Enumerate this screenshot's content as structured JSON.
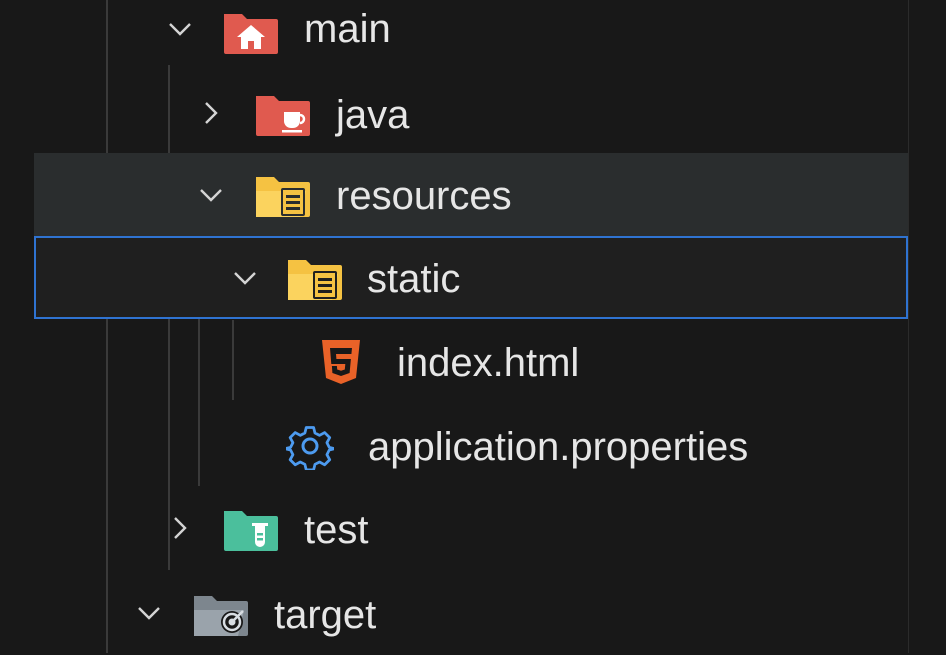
{
  "tree": {
    "main": {
      "label": "main",
      "expanded": true
    },
    "java": {
      "label": "java",
      "expanded": false
    },
    "resources": {
      "label": "resources",
      "expanded": true
    },
    "static": {
      "label": "static",
      "expanded": true,
      "selected": true
    },
    "index": {
      "label": "index.html"
    },
    "properties": {
      "label": "application.properties"
    },
    "test": {
      "label": "test",
      "expanded": false
    },
    "target": {
      "label": "target",
      "expanded": true
    }
  },
  "colors": {
    "background": "#181818",
    "hover_row": "#2a2d2e",
    "selection_border": "#2f73d1",
    "main_folder": "#e05a4f",
    "java_folder": "#e05a4f",
    "resources_folder": "#f5c242",
    "test_folder": "#4bbf9c",
    "target_folder": "#9aa3ab",
    "html_icon": "#e96228",
    "gear_icon": "#4d9bf0"
  },
  "icons": {
    "main": "folder-home-icon",
    "java": "folder-java-icon",
    "resources": "folder-resource-icon",
    "static": "folder-resource-icon",
    "index": "html5-icon",
    "properties": "gear-icon",
    "test": "folder-test-icon",
    "target": "folder-target-icon"
  }
}
